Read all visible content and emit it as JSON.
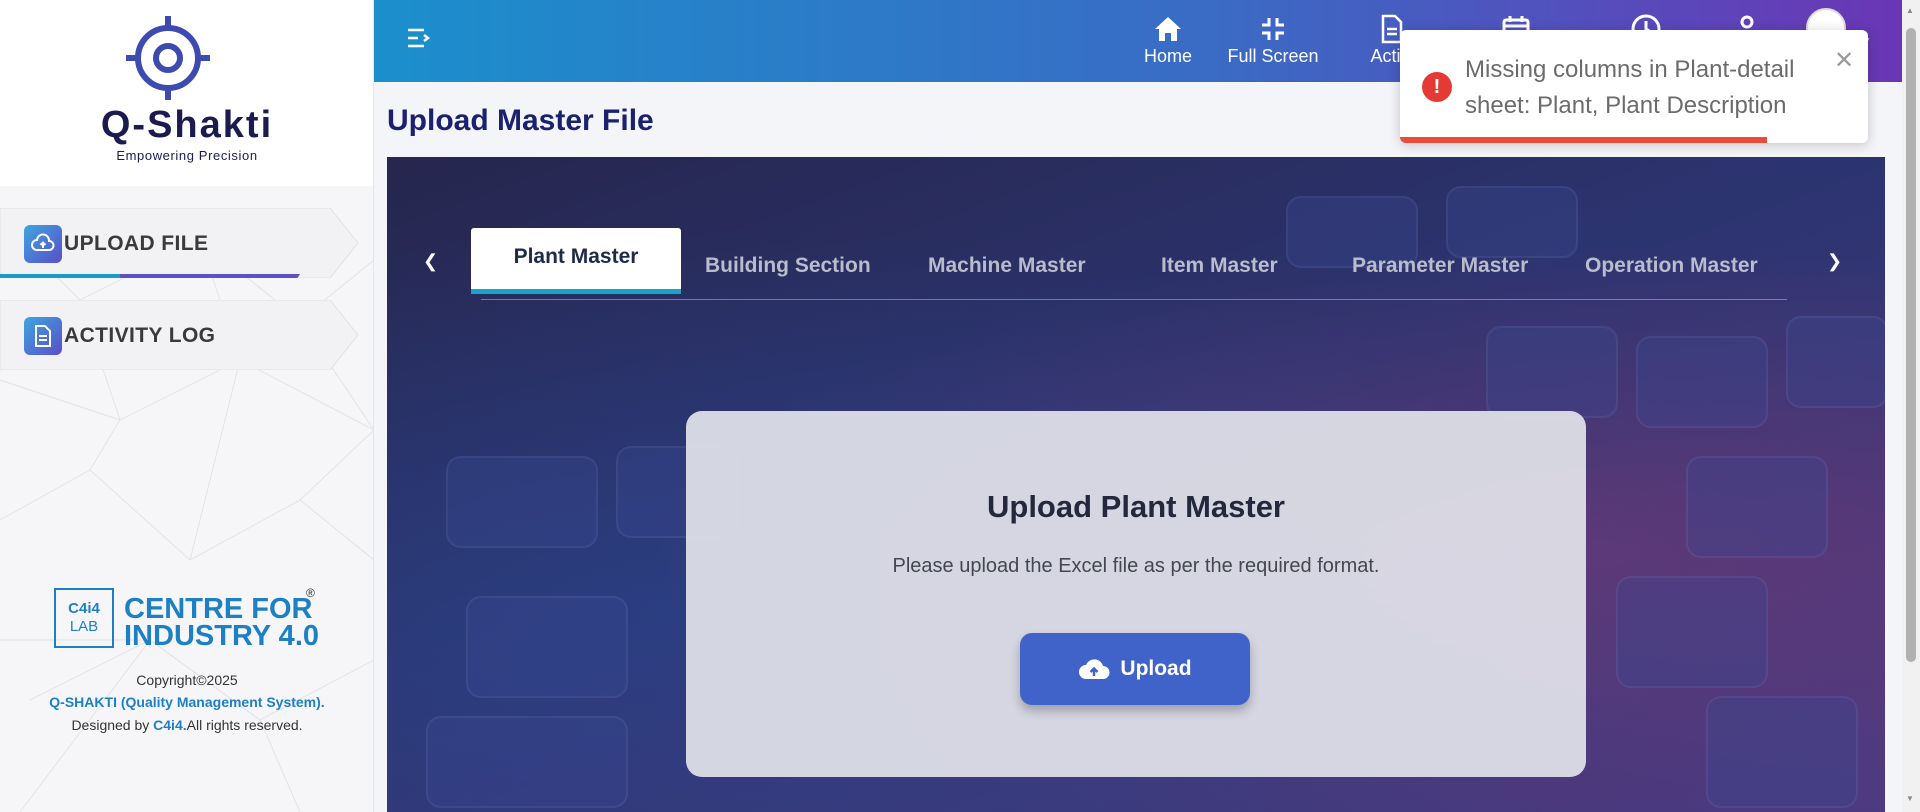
{
  "brand": {
    "name": "Q-Shakti",
    "tagline": "Empowering Precision"
  },
  "sidebar": {
    "items": [
      {
        "label": "UPLOAD FILE",
        "icon": "cloud-upload-icon"
      },
      {
        "label": "ACTIVITY LOG",
        "icon": "document-icon"
      }
    ]
  },
  "footer": {
    "lab_badge_line1": "C4i4",
    "lab_badge_line2": "LAB",
    "lab_name_line1": "CENTRE FOR",
    "lab_name_line2": "INDUSTRY 4.0",
    "registered": "®",
    "copyright": "Copyright©2025",
    "system_name": "Q-SHAKTI (Quality Management System).",
    "designed_by_prefix": "Designed by ",
    "designed_by_name": "C4i4.",
    "designed_by_suffix": "All rights reserved."
  },
  "header": {
    "nav": [
      {
        "label": "Home",
        "icon": "home-icon"
      },
      {
        "label": "Full Screen",
        "icon": "fullscreen-exit-icon"
      },
      {
        "label": "Activi",
        "icon": "document-icon"
      }
    ],
    "extra_icons": [
      "calendar-icon",
      "clock-icon",
      "user-icon"
    ]
  },
  "page": {
    "title": "Upload Master File"
  },
  "tabs": [
    {
      "label": "Plant Master",
      "active": true
    },
    {
      "label": "Building Section",
      "active": false
    },
    {
      "label": "Machine Master",
      "active": false
    },
    {
      "label": "Item Master",
      "active": false
    },
    {
      "label": "Parameter Master",
      "active": false
    },
    {
      "label": "Operation Master",
      "active": false
    }
  ],
  "upload_card": {
    "title": "Upload Plant Master",
    "subtitle": "Please upload the Excel file as per the required format.",
    "button_label": "Upload"
  },
  "toast": {
    "message": "Missing columns in Plant-detail sheet: Plant, Plant Description",
    "type": "error",
    "color": "#e53935",
    "close": "✕"
  },
  "colors": {
    "accent_blue": "#1d7fc4",
    "title_navy": "#1a2170",
    "button": "#3f63c8",
    "tab_underline": "#1aa3c8"
  }
}
